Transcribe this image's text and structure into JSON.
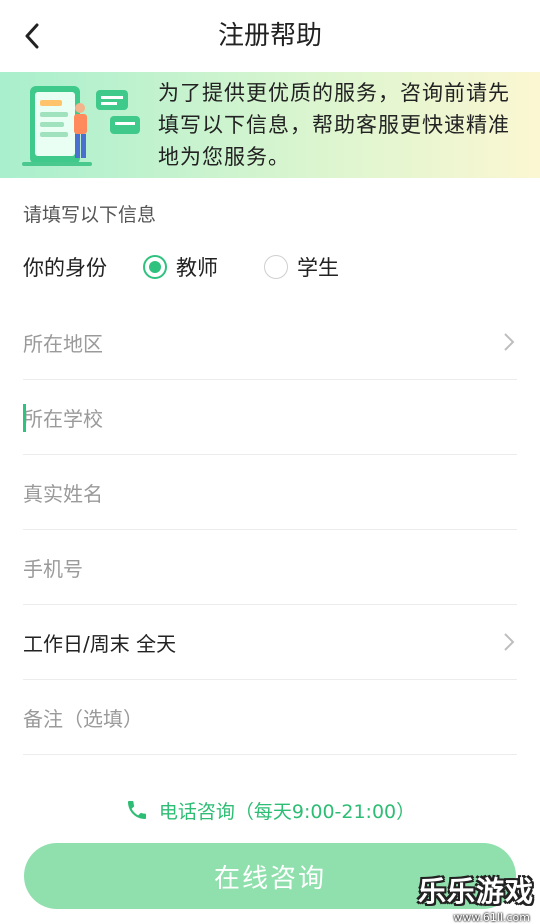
{
  "header": {
    "title": "注册帮助",
    "back_icon": "chevron-left-icon"
  },
  "banner": {
    "text": "为了提供更优质的服务，咨询前请先填写以下信息，帮助客服更快速精准地为您服务。"
  },
  "form": {
    "section_label": "请填写以下信息",
    "identity": {
      "label": "你的身份",
      "options": [
        {
          "label": "教师",
          "checked": true
        },
        {
          "label": "学生",
          "checked": false
        }
      ]
    },
    "fields": {
      "region": {
        "placeholder": "所在地区"
      },
      "school": {
        "placeholder": "所在学校"
      },
      "name": {
        "placeholder": "真实姓名"
      },
      "phone": {
        "placeholder": "手机号"
      },
      "time": {
        "value": "工作日/周末 全天"
      },
      "remark": {
        "placeholder": "备注（选填）"
      }
    }
  },
  "phone_consult": {
    "text": "电话咨询（每天9:00-21:00）",
    "icon": "phone-icon"
  },
  "consult_button": {
    "label": "在线咨询"
  },
  "watermark": {
    "main": "乐乐游戏",
    "sub": "www.61ll.com"
  },
  "colors": {
    "accent": "#2ec27e",
    "button": "#8fe0ad",
    "banner_start": "#a9efcd",
    "banner_end": "#fbf7d2"
  }
}
